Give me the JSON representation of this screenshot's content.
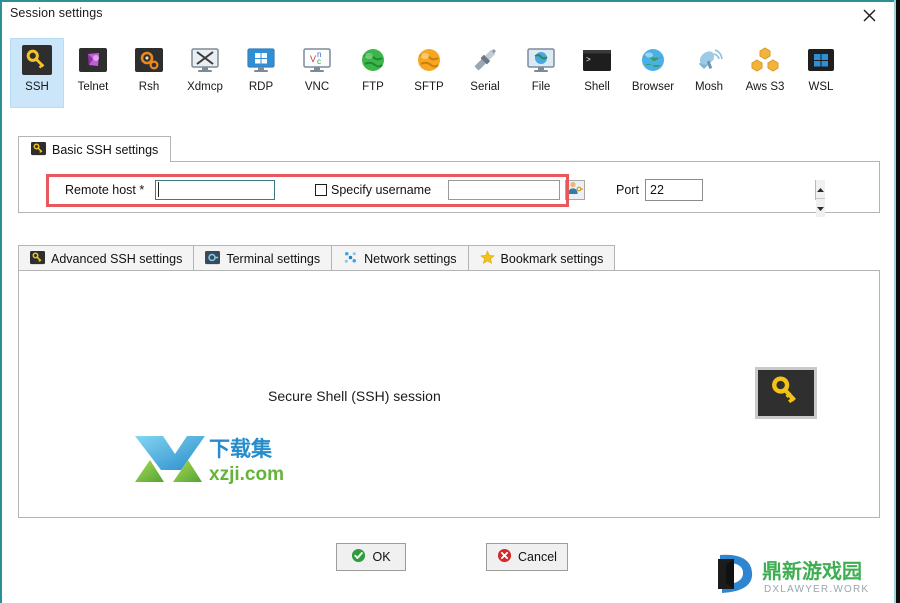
{
  "window": {
    "title": "Session settings",
    "close_icon": "close-icon",
    "frame_color": "#2e8f95"
  },
  "protocols": [
    {
      "id": "ssh",
      "label": "SSH",
      "icon": "key-icon",
      "selected": true
    },
    {
      "id": "telnet",
      "label": "Telnet",
      "icon": "telnet-icon",
      "selected": false
    },
    {
      "id": "rsh",
      "label": "Rsh",
      "icon": "gears-icon",
      "selected": false
    },
    {
      "id": "xdmcp",
      "label": "Xdmcp",
      "icon": "x-monitor-icon",
      "selected": false
    },
    {
      "id": "rdp",
      "label": "RDP",
      "icon": "windows-monitor-icon",
      "selected": false
    },
    {
      "id": "vnc",
      "label": "VNC",
      "icon": "vnc-monitor-icon",
      "selected": false
    },
    {
      "id": "ftp",
      "label": "FTP",
      "icon": "green-globe-icon",
      "selected": false
    },
    {
      "id": "sftp",
      "label": "SFTP",
      "icon": "orange-globe-icon",
      "selected": false
    },
    {
      "id": "serial",
      "label": "Serial",
      "icon": "serial-plug-icon",
      "selected": false
    },
    {
      "id": "file",
      "label": "File",
      "icon": "file-monitor-icon",
      "selected": false
    },
    {
      "id": "shell",
      "label": "Shell",
      "icon": "terminal-icon",
      "selected": false
    },
    {
      "id": "browser",
      "label": "Browser",
      "icon": "blue-globe-icon",
      "selected": false
    },
    {
      "id": "mosh",
      "label": "Mosh",
      "icon": "satellite-icon",
      "selected": false
    },
    {
      "id": "awss3",
      "label": "Aws S3",
      "icon": "aws-s3-icon",
      "selected": false
    },
    {
      "id": "wsl",
      "label": "WSL",
      "icon": "windows-icon",
      "selected": false
    }
  ],
  "basic_tab": {
    "label": "Basic SSH settings",
    "icon": "key-icon"
  },
  "form": {
    "remote_host_label": "Remote host *",
    "remote_host_value": "",
    "remote_host_placeholder": "",
    "specify_username_label": "Specify username",
    "specify_username_checked": false,
    "username_value": "",
    "username_placeholder": "",
    "user_key_icon": "user-key-icon",
    "port_label": "Port",
    "port_value": "22",
    "spin_up_icon": "chevron-up-icon",
    "spin_down_icon": "chevron-down-icon",
    "highlight_color": "#e8595e"
  },
  "lower_tabs": [
    {
      "label": "Advanced SSH settings",
      "icon": "key-icon"
    },
    {
      "label": "Terminal settings",
      "icon": "terminal-settings-icon"
    },
    {
      "label": "Network settings",
      "icon": "network-nodes-icon"
    },
    {
      "label": "Bookmark settings",
      "icon": "star-icon"
    }
  ],
  "main_panel": {
    "caption": "Secure Shell (SSH) session",
    "badge_icon": "key-icon"
  },
  "watermarks": {
    "left": {
      "cn": "下载集",
      "domain": "xzji.com",
      "logo_icon": "x-arrow-logo-icon"
    },
    "bottom_right": {
      "cn": "鼎新游戏园",
      "domain": "DXLAWYER.WORK",
      "logo_icon": "d-logo-icon"
    }
  },
  "footer": {
    "ok_label": "OK",
    "ok_icon": "check-circle-icon",
    "cancel_label": "Cancel",
    "cancel_icon": "x-circle-icon"
  }
}
